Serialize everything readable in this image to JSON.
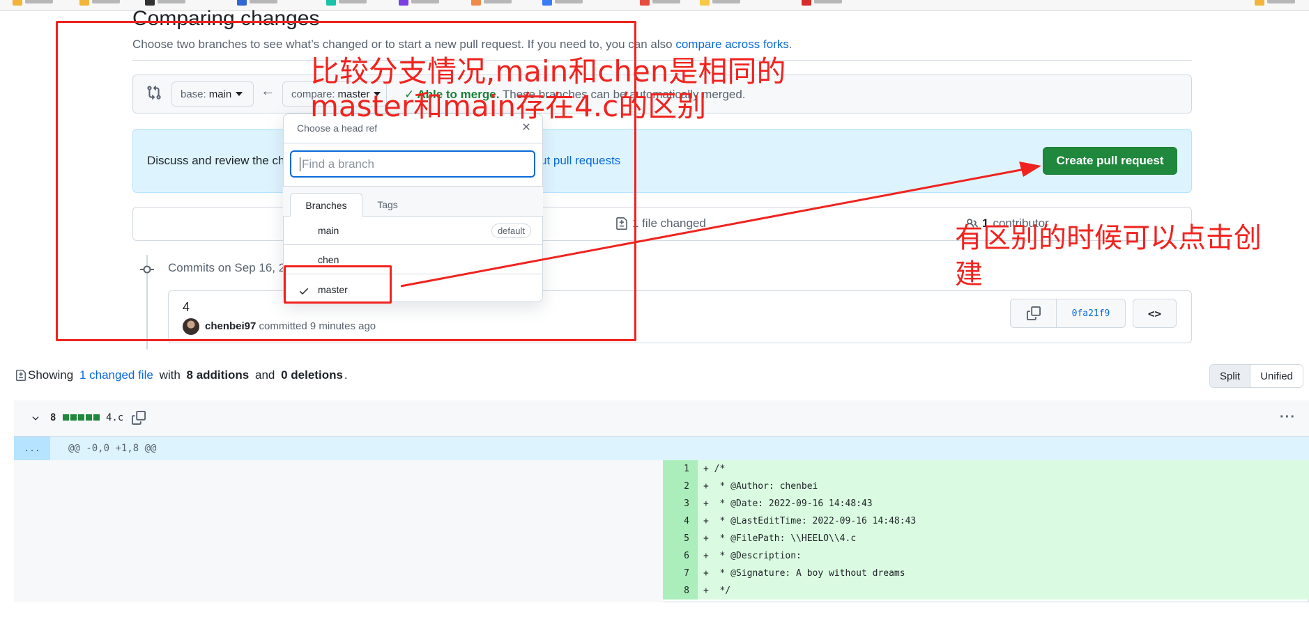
{
  "colors": {
    "accent_blue": "#0969da",
    "success_green": "#1f883d",
    "annotation_red": "#f0231f",
    "add_line_bg": "#dafbe1"
  },
  "header": {
    "title": "Comparing changes",
    "subtitle_prefix": "Choose two branches to see what’s changed or to start a new pull request. If you need to, you can also ",
    "subtitle_link": "compare across forks",
    "subtitle_suffix": "."
  },
  "compare": {
    "base_label": "base:",
    "base_value": "main",
    "compare_label": "compare:",
    "compare_value": "master",
    "arrow_icon": "arrow-left-icon",
    "merge_ok": "✓ Able to merge.",
    "merge_text": " These branches can be automatically merged."
  },
  "discuss": {
    "text": "Discuss and review the ch",
    "link": "ut pull requests",
    "create_button": "Create pull request"
  },
  "stats": {
    "files_changed": "1 file changed",
    "contributors_count": "1",
    "contributors_label": "contributor"
  },
  "commits": {
    "date_header": "Commits on Sep 16, 2",
    "items": [
      {
        "title": "4",
        "author": "chenbei97",
        "action": "committed",
        "time": "9 minutes ago",
        "sha": "0fa21f9",
        "browse_label": "<>"
      }
    ]
  },
  "dropdown": {
    "title": "Choose a head ref",
    "search_placeholder": "Find a branch",
    "tabs": [
      "Branches",
      "Tags"
    ],
    "branches": [
      {
        "name": "main",
        "badge": "default",
        "selected": false
      },
      {
        "name": "chen",
        "badge": "",
        "selected": false
      },
      {
        "name": "master",
        "badge": "",
        "selected": true
      }
    ]
  },
  "showing": {
    "prefix": "Showing",
    "link": "1 changed file",
    "with": "with",
    "additions": "8 additions",
    "and": "and",
    "deletions": "0 deletions",
    "end": "."
  },
  "view": {
    "split": "Split",
    "unified": "Unified"
  },
  "diff": {
    "count": "8",
    "filename": "4.c",
    "hunk_expand": "...",
    "hunk_header": "@@ -0,0 +1,8 @@",
    "lines": [
      {
        "num": "1",
        "code": "+ /*"
      },
      {
        "num": "2",
        "code": "+  * @Author: chenbei"
      },
      {
        "num": "3",
        "code": "+  * @Date: 2022-09-16 14:48:43"
      },
      {
        "num": "4",
        "code": "+  * @LastEditTime: 2022-09-16 14:48:43"
      },
      {
        "num": "5",
        "code": "+  * @FilePath: \\\\HEELO\\\\4.c"
      },
      {
        "num": "6",
        "code": "+  * @Description:"
      },
      {
        "num": "7",
        "code": "+  * @Signature: A boy without dreams"
      },
      {
        "num": "8",
        "code": "+  */"
      }
    ]
  },
  "annotations": {
    "note1_line1": "比较分支情况,main和chen是相同的",
    "note1_line2": "master和main存在4.c的区别",
    "note2_line1": "有区别的时候可以点击创",
    "note2_line2": "建"
  }
}
